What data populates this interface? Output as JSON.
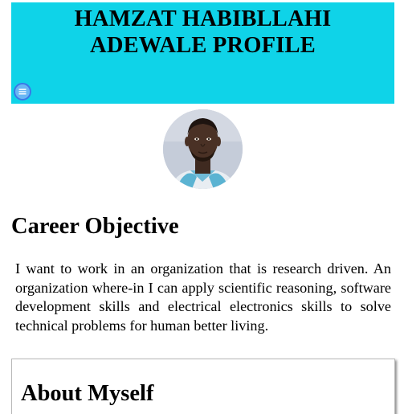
{
  "header": {
    "title_line1": "HAMZAT HABIBLLAHI",
    "title_line2": "ADEWALE PROFILE",
    "menu_icon": "hamburger-menu-icon",
    "background_color": "#0fd3e8"
  },
  "profile": {
    "avatar": "profile-photo"
  },
  "career_objective": {
    "heading": "Career Objective",
    "text": "I want to work in an organization that is research driven. An organization where-in I can apply scientific reasoning, software development skills and electrical electronics skills to solve technical problems for human better living."
  },
  "about": {
    "heading": "About Myself"
  }
}
